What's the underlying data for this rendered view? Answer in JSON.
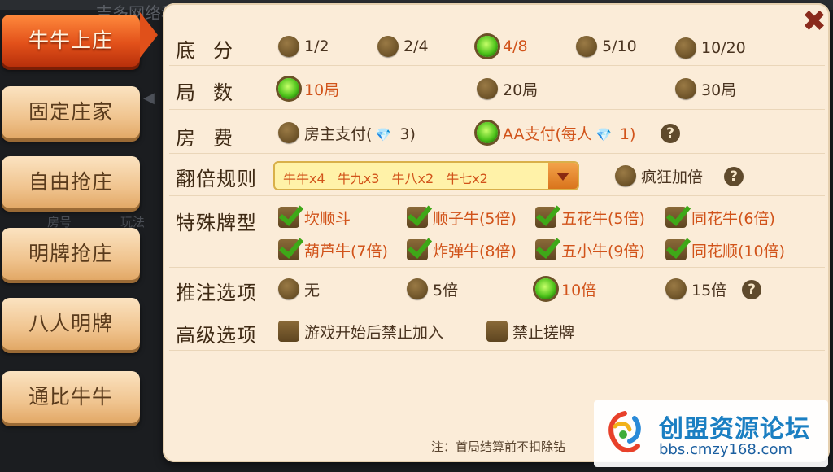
{
  "background": {
    "company": "吉多网络科技",
    "room_col": "房号",
    "play_col": "玩法"
  },
  "tabs": [
    {
      "label": "牛牛上庄",
      "active": true
    },
    {
      "label": "固定庄家",
      "active": false
    },
    {
      "label": "自由抢庄",
      "active": false
    },
    {
      "label": "明牌抢庄",
      "active": false
    },
    {
      "label": "八人明牌",
      "active": false
    },
    {
      "label": "通比牛牛",
      "active": false
    }
  ],
  "close_label": "✖",
  "base_score": {
    "label": "底分",
    "options": [
      {
        "text": "1/2",
        "selected": false
      },
      {
        "text": "2/4",
        "selected": false
      },
      {
        "text": "4/8",
        "selected": true
      },
      {
        "text": "5/10",
        "selected": false
      },
      {
        "text": "10/20",
        "selected": false
      }
    ]
  },
  "rounds": {
    "label": "局数",
    "options": [
      {
        "text": "10局",
        "selected": true
      },
      {
        "text": "20局",
        "selected": false
      },
      {
        "text": "30局",
        "selected": false
      }
    ]
  },
  "room_fee": {
    "label": "房费",
    "options": [
      {
        "text_before": "房主支付(",
        "text_after": " 3)",
        "selected": false
      },
      {
        "text_before": "AA支付(每人",
        "text_after": " 1)",
        "selected": true
      }
    ]
  },
  "multiplier": {
    "label": "翻倍规则",
    "value": "牛牛x4 牛九x3 牛八x2 牛七x2",
    "crazy_label": "疯狂加倍",
    "crazy_checked": false
  },
  "special": {
    "label": "特殊牌型",
    "options": [
      {
        "text": "坎顺斗",
        "checked": true
      },
      {
        "text": "顺子牛(5倍)",
        "checked": true
      },
      {
        "text": "五花牛(5倍)",
        "checked": true
      },
      {
        "text": "同花牛(6倍)",
        "checked": true
      },
      {
        "text": "葫芦牛(7倍)",
        "checked": true
      },
      {
        "text": "炸弹牛(8倍)",
        "checked": true
      },
      {
        "text": "五小牛(9倍)",
        "checked": true
      },
      {
        "text": "同花顺(10倍)",
        "checked": true
      }
    ]
  },
  "push_bet": {
    "label": "推注选项",
    "options": [
      {
        "text": "无",
        "selected": false
      },
      {
        "text": "5倍",
        "selected": false
      },
      {
        "text": "10倍",
        "selected": true
      },
      {
        "text": "15倍",
        "selected": false
      }
    ]
  },
  "advanced": {
    "label": "高级选项",
    "options": [
      {
        "text": "游戏开始后禁止加入",
        "checked": false
      },
      {
        "text": "禁止搓牌",
        "checked": false
      }
    ]
  },
  "help_label": "?",
  "note": "注：首局结算前不扣除钻",
  "watermark": {
    "title": "创盟资源论坛",
    "url": "bbs.cmzy168.com"
  },
  "colors": {
    "accent_orange": "#d1531a",
    "selected_green": "#4cc21a",
    "panel_bg": "#fbecd8"
  }
}
